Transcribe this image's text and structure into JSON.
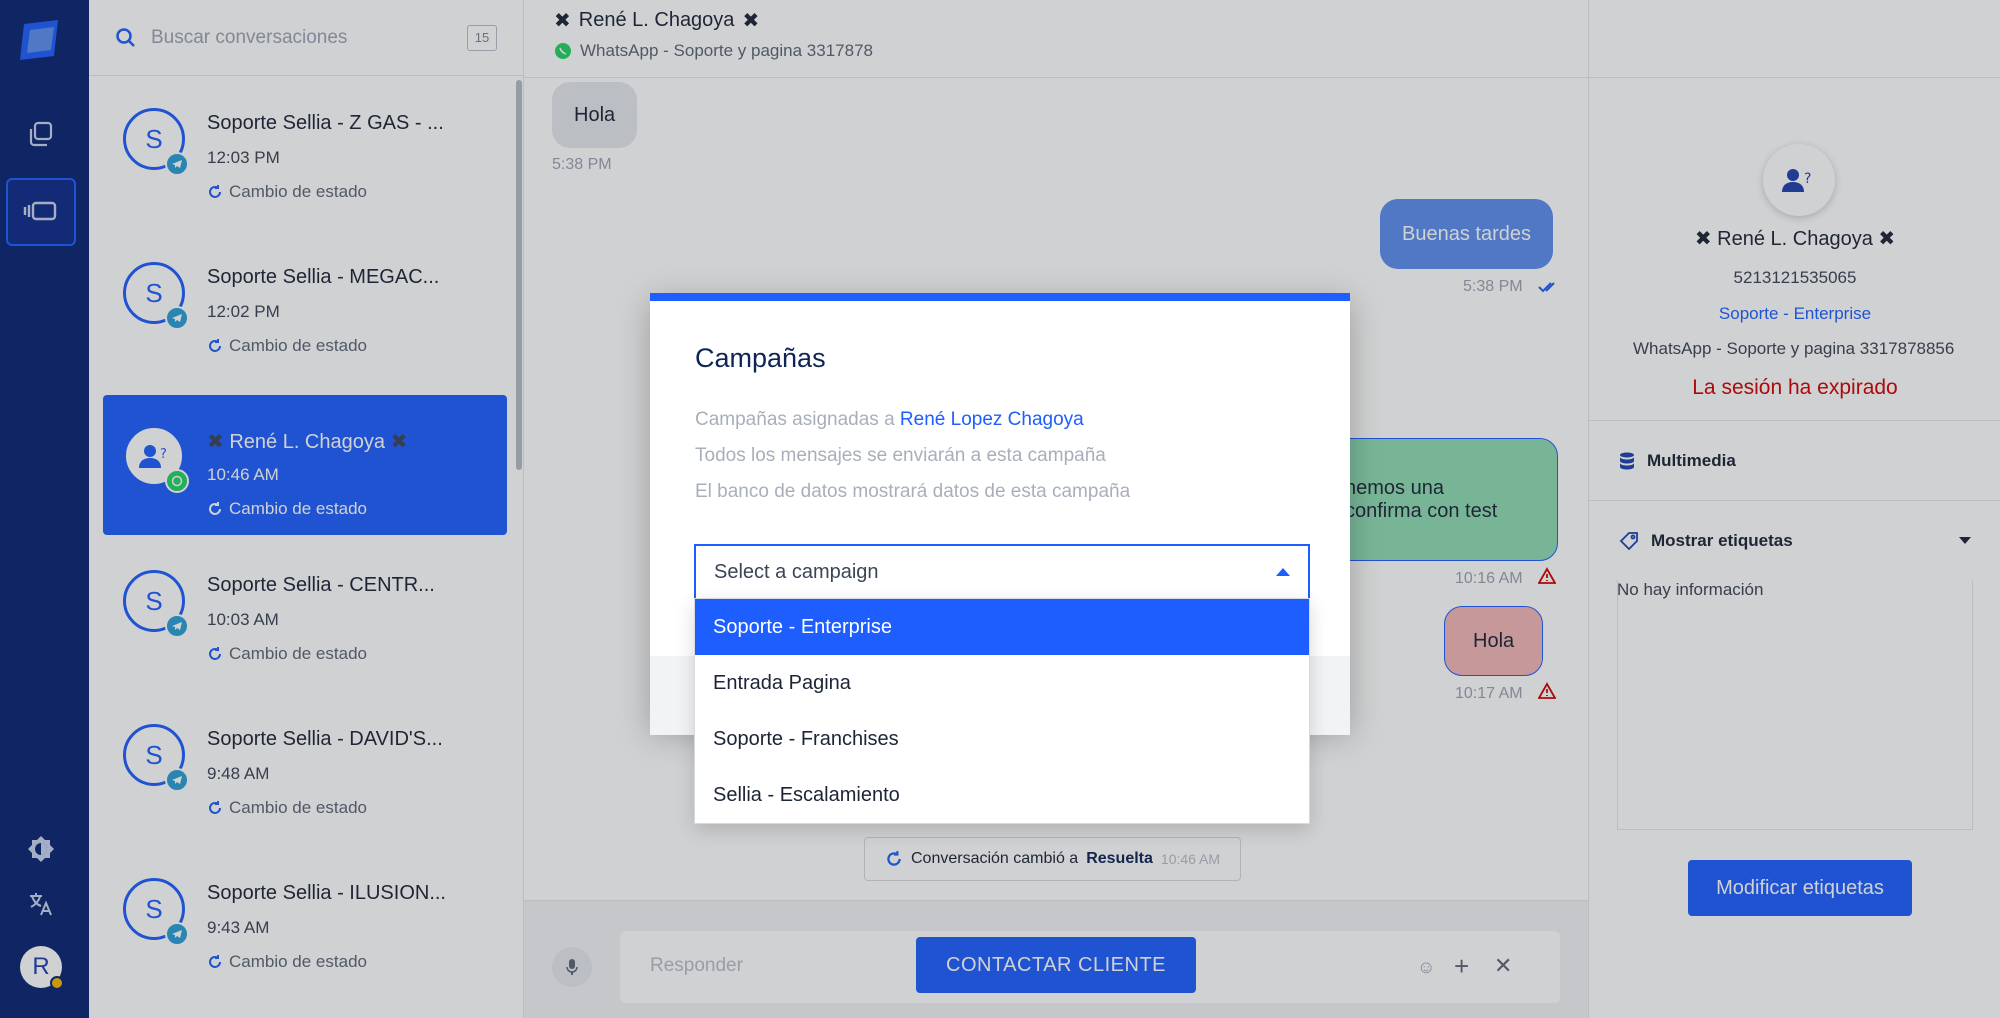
{
  "search": {
    "placeholder": "Buscar conversaciones",
    "count": "15"
  },
  "rail": {
    "avatar_letter": "R"
  },
  "conversations": [
    {
      "avatar": "S",
      "title": "Soporte Sellia - Z GAS - ...",
      "time": "12:03 PM",
      "status": "Cambio de estado",
      "channel_icon": "telegram-icon"
    },
    {
      "avatar": "S",
      "title": "Soporte Sellia - MEGAC...",
      "time": "12:02 PM",
      "status": "Cambio de estado",
      "channel_icon": "telegram-icon"
    },
    {
      "avatar": "",
      "title": "René L. Chagoya",
      "time": "10:46 AM",
      "status": "Cambio de estado",
      "channel_icon": "whatsapp-icon"
    },
    {
      "avatar": "S",
      "title": "Soporte Sellia - CENTR...",
      "time": "10:03 AM",
      "status": "Cambio de estado",
      "channel_icon": "telegram-icon"
    },
    {
      "avatar": "S",
      "title": "Soporte Sellia - DAVID'S...",
      "time": "9:48 AM",
      "status": "Cambio de estado",
      "channel_icon": "telegram-icon"
    },
    {
      "avatar": "S",
      "title": "Soporte Sellia - ILUSION...",
      "time": "9:43 AM",
      "status": "Cambio de estado",
      "channel_icon": "telegram-icon"
    }
  ],
  "chat": {
    "contact_name": "René L. Chagoya",
    "channel": "WhatsApp - Soporte y pagina 3317878",
    "messages": [
      {
        "text": "Hola",
        "time": "5:38 PM"
      },
      {
        "text": "Buenas tardes",
        "time": "5:38 PM"
      },
      {
        "text_line1": "nemos una",
        "text_line2": "confirma con test",
        "time": "10:16 AM"
      },
      {
        "text": "Hola",
        "time": "10:17 AM"
      }
    ],
    "system_message_prefix": "Conversación cambió a",
    "system_message_state": "Resuelta",
    "system_message_time": "10:46 AM",
    "composer_placeholder": "Responder",
    "contact_button": "CONTACTAR CLIENTE"
  },
  "contact_panel": {
    "name": "René L. Chagoya",
    "phone": "5213121535065",
    "campaign": "Soporte - Enterprise",
    "channel": "WhatsApp - Soporte y pagina 3317878856",
    "expired": "La sesión ha expirado",
    "multimedia": "Multimedia",
    "tags_label": "Mostrar etiquetas",
    "no_info": "No hay información",
    "modify_tags": "Modificar etiquetas"
  },
  "modal": {
    "title": "Campañas",
    "line1_prefix": "Campañas asignadas a",
    "line1_name": "René Lopez Chagoya",
    "line2": "Todos los mensajes se enviarán a esta campaña",
    "line3": "El banco de datos mostrará datos de esta campaña",
    "select_placeholder": "Select a campaign",
    "options": [
      "Soporte - Enterprise",
      "Entrada Pagina",
      "Soporte - Franchises",
      "Sellia - Escalamiento"
    ]
  },
  "colors": {
    "brand": "#1e5eff",
    "rail": "#0a2472",
    "expired": "#d10000",
    "bubble_out": "#5b8def",
    "bubble_green": "#8fdcb4",
    "bubble_red": "#f3b6b6"
  }
}
